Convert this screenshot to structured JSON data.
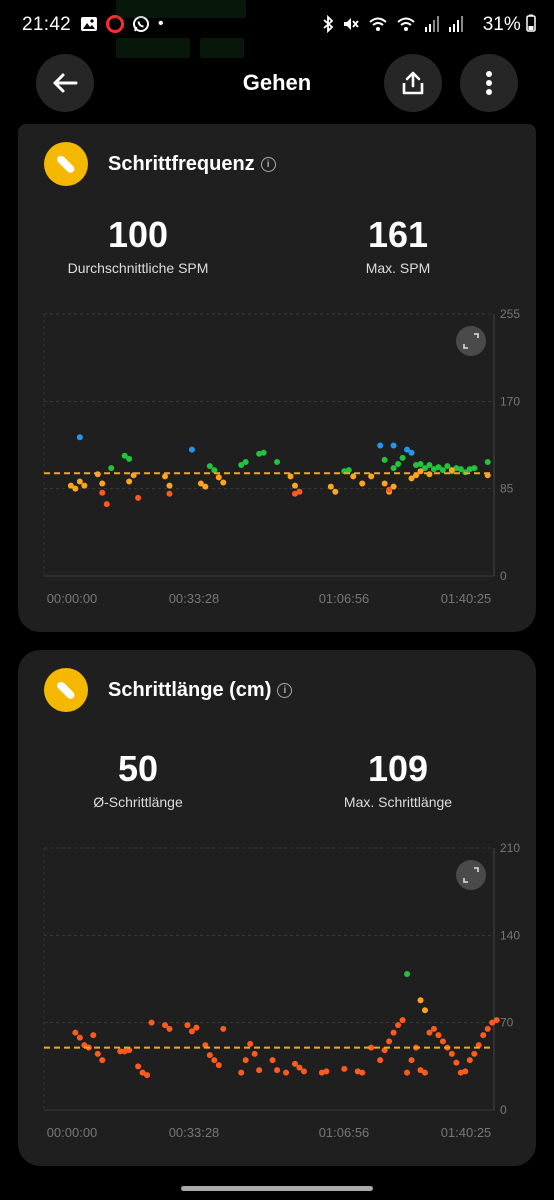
{
  "status_bar": {
    "time": "21:42",
    "battery": "31%",
    "dot": "•"
  },
  "header": {
    "title": "Gehen"
  },
  "cadence_card": {
    "title": "Schrittfrequenz",
    "avg_value": "100",
    "avg_label": "Durchschnittliche SPM",
    "max_value": "161",
    "max_label": "Max. SPM"
  },
  "stride_card": {
    "title": "Schrittlänge (cm)",
    "avg_value": "50",
    "avg_label": "Ø-Schrittlänge",
    "max_value": "109",
    "max_label": "Max. Schrittlänge"
  },
  "colors": {
    "badge": "#f5b800",
    "orange": "#ff5a1f",
    "amber": "#ffa51f",
    "green": "#22c43c",
    "blue": "#2196f3",
    "avg_line": "#f5a623"
  },
  "chart_data": [
    {
      "type": "scatter",
      "title": "Schrittfrequenz",
      "xlabel": "",
      "ylabel": "",
      "x_ticks": [
        "00:00:00",
        "00:33:28",
        "01:06:56",
        "01:40:25"
      ],
      "y_ticks": [
        0,
        85,
        170,
        255
      ],
      "ylim": [
        0,
        255
      ],
      "xlim_minutes": [
        0,
        100.4
      ],
      "average": 100,
      "grid": true,
      "series": [
        {
          "color": "blue",
          "points": [
            [
              8,
              135
            ],
            [
              33,
              123
            ],
            [
              75,
              127
            ],
            [
              78,
              127
            ],
            [
              81,
              123
            ],
            [
              82,
              120
            ]
          ]
        },
        {
          "color": "green",
          "points": [
            [
              15,
              105
            ],
            [
              18,
              117
            ],
            [
              19,
              114
            ],
            [
              37,
              107
            ],
            [
              38,
              103
            ],
            [
              44,
              108
            ],
            [
              45,
              111
            ],
            [
              48,
              119
            ],
            [
              49,
              120
            ],
            [
              52,
              111
            ],
            [
              67,
              102
            ],
            [
              68,
              103
            ],
            [
              76,
              113
            ],
            [
              78,
              105
            ],
            [
              79,
              109
            ],
            [
              80,
              115
            ],
            [
              83,
              108
            ],
            [
              84,
              109
            ],
            [
              85,
              105
            ],
            [
              86,
              108
            ],
            [
              87,
              104
            ],
            [
              88,
              106
            ],
            [
              89,
              103
            ],
            [
              90,
              107
            ],
            [
              91,
              102
            ],
            [
              92,
              105
            ],
            [
              93,
              104
            ],
            [
              94,
              101
            ],
            [
              95,
              104
            ],
            [
              96,
              105
            ],
            [
              99,
              111
            ]
          ]
        },
        {
          "color": "amber",
          "points": [
            [
              6,
              88
            ],
            [
              7,
              85
            ],
            [
              8,
              92
            ],
            [
              9,
              88
            ],
            [
              12,
              99
            ],
            [
              13,
              90
            ],
            [
              19,
              92
            ],
            [
              20,
              98
            ],
            [
              27,
              97
            ],
            [
              28,
              88
            ],
            [
              35,
              90
            ],
            [
              36,
              87
            ],
            [
              39,
              96
            ],
            [
              40,
              91
            ],
            [
              55,
              97
            ],
            [
              56,
              88
            ],
            [
              64,
              87
            ],
            [
              65,
              82
            ],
            [
              69,
              97
            ],
            [
              71,
              90
            ],
            [
              73,
              97
            ],
            [
              76,
              90
            ],
            [
              77,
              82
            ],
            [
              78,
              87
            ],
            [
              82,
              95
            ],
            [
              83,
              98
            ],
            [
              84,
              102
            ],
            [
              86,
              99
            ],
            [
              91,
              103
            ],
            [
              99,
              98
            ]
          ]
        },
        {
          "color": "orange",
          "points": [
            [
              13,
              81
            ],
            [
              14,
              70
            ],
            [
              21,
              76
            ],
            [
              28,
              80
            ],
            [
              56,
              80
            ],
            [
              57,
              82
            ],
            [
              77,
              84
            ]
          ]
        }
      ]
    },
    {
      "type": "scatter",
      "title": "Schrittlänge (cm)",
      "xlabel": "",
      "ylabel": "",
      "x_ticks": [
        "00:00:00",
        "00:33:28",
        "01:06:56",
        "01:40:25"
      ],
      "y_ticks": [
        0,
        70,
        140,
        210
      ],
      "ylim": [
        0,
        210
      ],
      "xlim_minutes": [
        0,
        100.4
      ],
      "average": 50,
      "grid": true,
      "series": [
        {
          "color": "green",
          "points": [
            [
              81,
              109
            ]
          ]
        },
        {
          "color": "amber",
          "points": [
            [
              84,
              88
            ],
            [
              85,
              80
            ]
          ]
        },
        {
          "color": "orange",
          "points": [
            [
              7,
              62
            ],
            [
              8,
              58
            ],
            [
              9,
              52
            ],
            [
              10,
              50
            ],
            [
              11,
              60
            ],
            [
              12,
              45
            ],
            [
              13,
              40
            ],
            [
              17,
              47
            ],
            [
              18,
              47
            ],
            [
              19,
              48
            ],
            [
              21,
              35
            ],
            [
              22,
              30
            ],
            [
              23,
              28
            ],
            [
              24,
              70
            ],
            [
              27,
              68
            ],
            [
              28,
              65
            ],
            [
              32,
              68
            ],
            [
              33,
              63
            ],
            [
              34,
              66
            ],
            [
              36,
              52
            ],
            [
              37,
              44
            ],
            [
              38,
              40
            ],
            [
              39,
              36
            ],
            [
              40,
              65
            ],
            [
              44,
              30
            ],
            [
              45,
              40
            ],
            [
              46,
              53
            ],
            [
              47,
              45
            ],
            [
              48,
              32
            ],
            [
              51,
              40
            ],
            [
              52,
              32
            ],
            [
              54,
              30
            ],
            [
              56,
              37
            ],
            [
              57,
              34
            ],
            [
              58,
              31
            ],
            [
              62,
              30
            ],
            [
              63,
              31
            ],
            [
              67,
              33
            ],
            [
              70,
              31
            ],
            [
              71,
              30
            ],
            [
              73,
              50
            ],
            [
              75,
              40
            ],
            [
              76,
              48
            ],
            [
              77,
              55
            ],
            [
              78,
              62
            ],
            [
              79,
              68
            ],
            [
              80,
              72
            ],
            [
              81,
              30
            ],
            [
              82,
              40
            ],
            [
              83,
              50
            ],
            [
              84,
              32
            ],
            [
              85,
              30
            ],
            [
              86,
              62
            ],
            [
              87,
              65
            ],
            [
              88,
              60
            ],
            [
              89,
              55
            ],
            [
              90,
              50
            ],
            [
              91,
              45
            ],
            [
              92,
              38
            ],
            [
              93,
              30
            ],
            [
              94,
              31
            ],
            [
              95,
              40
            ],
            [
              96,
              45
            ],
            [
              97,
              52
            ],
            [
              98,
              60
            ],
            [
              99,
              65
            ],
            [
              100,
              70
            ],
            [
              101,
              72
            ]
          ]
        }
      ]
    }
  ]
}
